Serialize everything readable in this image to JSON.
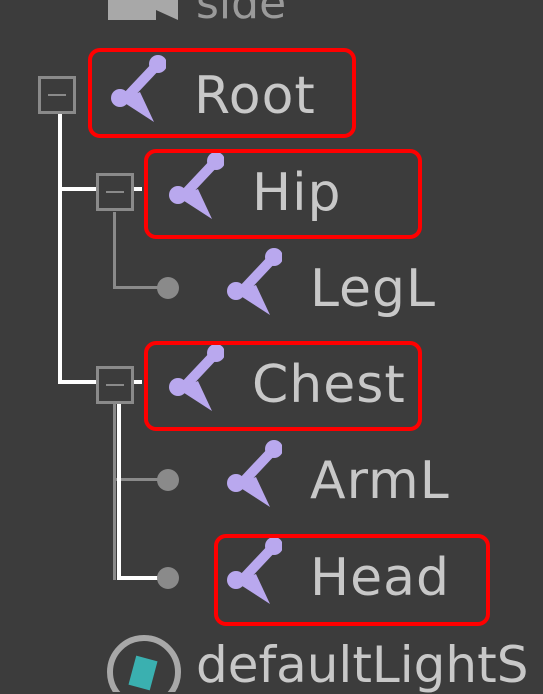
{
  "outliner": {
    "top_item_label": "side",
    "bottom_item_label": "defaultLightS",
    "nodes": [
      {
        "id": "root",
        "label": "Root",
        "type": "joint",
        "has_children": true,
        "highlighted": true
      },
      {
        "id": "hip",
        "label": "Hip",
        "type": "joint",
        "has_children": true,
        "highlighted": true
      },
      {
        "id": "legl",
        "label": "LegL",
        "type": "joint",
        "has_children": false,
        "highlighted": false
      },
      {
        "id": "chest",
        "label": "Chest",
        "type": "joint",
        "has_children": true,
        "highlighted": true
      },
      {
        "id": "arml",
        "label": "ArmL",
        "type": "joint",
        "has_children": false,
        "highlighted": false
      },
      {
        "id": "head",
        "label": "Head",
        "type": "joint",
        "has_children": false,
        "highlighted": true
      }
    ]
  },
  "colors": {
    "background": "#3c3c3c",
    "text": "#c8c8c8",
    "joint_icon": "#b9a8ee",
    "highlight": "#ff0000",
    "hierarchy_line": "#ffffff",
    "tree_line": "#8a8a8a"
  }
}
